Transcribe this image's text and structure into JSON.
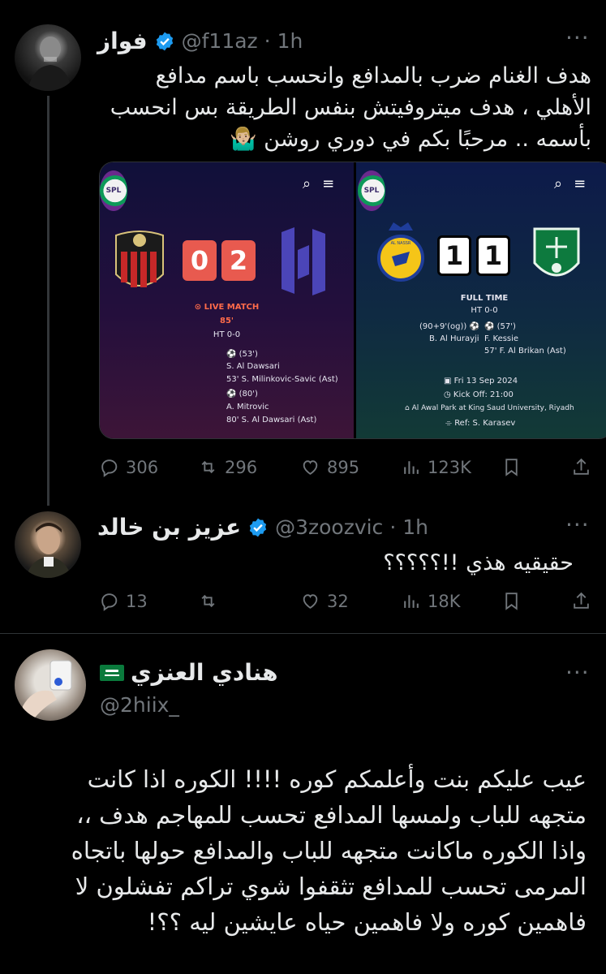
{
  "tweet1": {
    "display_name": "فواز",
    "handle": "@f11az",
    "time": "· 1h",
    "text_lines": [
      "هدف الغنام ضرب بالمدافع وانحسب باسم مدافع",
      "الأهلي ، هدف ميتروفيتش بنفس الطريقة بس انحسب",
      "بأسمه .. مرحبًا بكم في دوري روشن 🤷🏼‍♂️"
    ],
    "media": {
      "left": {
        "home_score": "0",
        "away_score": "2",
        "status": "LIVE MATCH",
        "minute": "85'",
        "ht": "HT 0-0",
        "events": [
          {
            "time": "(53')",
            "scorer": "S. Al Dawsari",
            "assist": "53' S. Milinkovic-Savic (Ast)"
          },
          {
            "time": "(80')",
            "scorer": "A. Mitrovic",
            "assist": "80' S. Al Dawsari (Ast)"
          }
        ]
      },
      "right": {
        "home_score": "1",
        "away_score": "1",
        "status": "FULL TIME",
        "ht": "HT 0-0",
        "home_event_time": "(90+9'(og))",
        "home_event_scorer": "B. Al Hurayji",
        "away_event_time": "(57')",
        "away_event_scorer": "F. Kessie",
        "away_event_assist": "57' F. Al Brikan (Ast)",
        "date": "Fri 13 Sep 2024",
        "kickoff": "Kick Off: 21:00",
        "venue": "Al Awal Park at King Saud University, Riyadh",
        "ref": "Ref: S. Karasev",
        "nassr_badge": "AL NASSR"
      }
    },
    "actions": {
      "replies": "306",
      "retweets": "296",
      "likes": "895",
      "views": "123K"
    }
  },
  "tweet2": {
    "display_name": "عزيز بن خالد",
    "handle": "@3zoozvic",
    "time": "· 1h",
    "text": "حقيقيه هذي !!؟؟؟؟؟",
    "actions": {
      "replies": "13",
      "retweets": "",
      "likes": "32",
      "views": "18K"
    }
  },
  "tweet3": {
    "display_name": "هنادي العنزي",
    "handle": "@2hiix_",
    "text_lines": [
      "عيب عليكم بنت وأعلمكم كوره !!!! الكوره اذا كانت",
      "متجهه للباب ولمسها المدافع تحسب للمهاجم هدف ،،",
      "واذا الكوره ماكانت متجهه للباب والمدافع حولها باتجاه",
      "المرمى تحسب للمدافع تثقفوا شوي تراكم تفشلون لا",
      "فاهمين كوره ولا فاهمين حياه عايشين ليه ؟؟!"
    ]
  },
  "colors": {
    "accent": "#1d9bf0",
    "muted": "#71767b",
    "text": "#e7e9ea",
    "background": "#000000"
  }
}
